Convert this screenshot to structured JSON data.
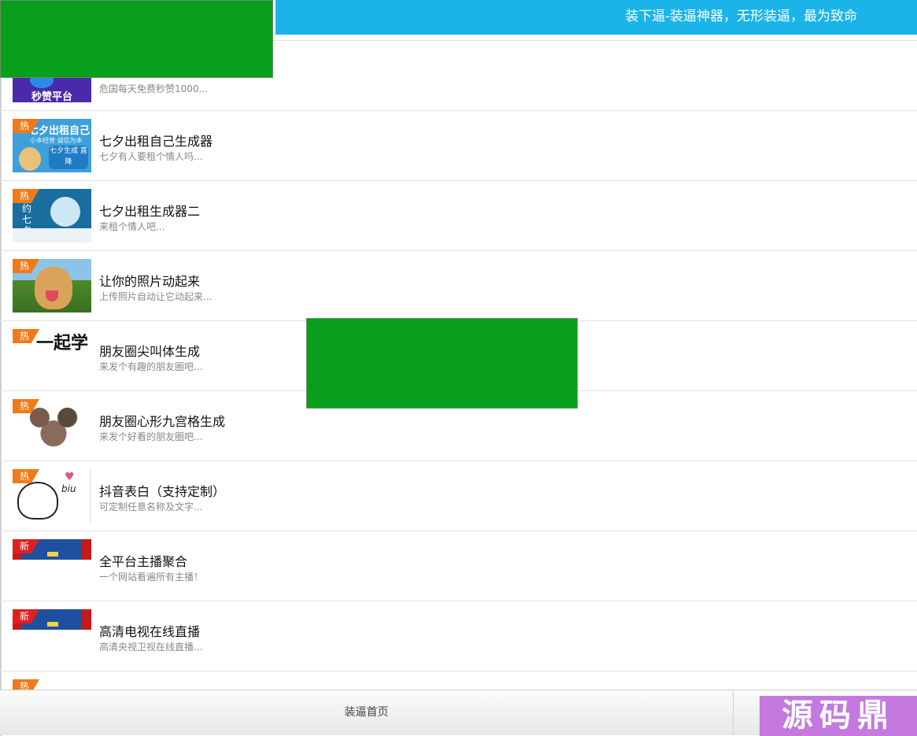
{
  "header": {
    "title": "装下逼-装逼神器，无形装逼，最为致命"
  },
  "items": [
    {
      "title": "",
      "desc": "危国每天免费秒赞1000...",
      "badge": ""
    },
    {
      "title": "七夕出租自己生成器",
      "desc": "七夕有人要租个情人吗...",
      "badge": "热"
    },
    {
      "title": "七夕出租生成器二",
      "desc": "来租个情人吧...",
      "badge": "热"
    },
    {
      "title": "让你的照片动起来",
      "desc": "上传照片自动让它动起来...",
      "badge": "热"
    },
    {
      "title": "朋友圈尖叫体生成",
      "desc": "来发个有趣的朋友圈吧...",
      "badge": "热"
    },
    {
      "title": "朋友圈心形九宫格生成",
      "desc": "来发个好看的朋友圈吧...",
      "badge": "热"
    },
    {
      "title": "抖音表白（支持定制）",
      "desc": "可定制任意名称及文字...",
      "badge": "热"
    },
    {
      "title": "全平台主播聚合",
      "desc": "一个网站看遍所有主播！",
      "badge": "新"
    },
    {
      "title": "高清电视在线直播",
      "desc": "高清央视卫视在线直播...",
      "badge": "新"
    },
    {
      "title": "",
      "desc": "",
      "badge": "热"
    }
  ],
  "thumbs": {
    "t0_text": "秒赞平台",
    "t1_text": "七夕出租自己",
    "t1_sub": "小本经营 诚信为本",
    "t1_tag": "七夕生成 直降",
    "t2_text": "约七夕",
    "t4_text": "一起学",
    "t6_text": "biu"
  },
  "footer": {
    "home_label": "装逼首页"
  },
  "watermark": {
    "text": "源码鼎"
  },
  "colors": {
    "header": "#1ab4e8",
    "hot": "#f07a1a",
    "new": "#e02020",
    "overlay": "#079f1c"
  }
}
